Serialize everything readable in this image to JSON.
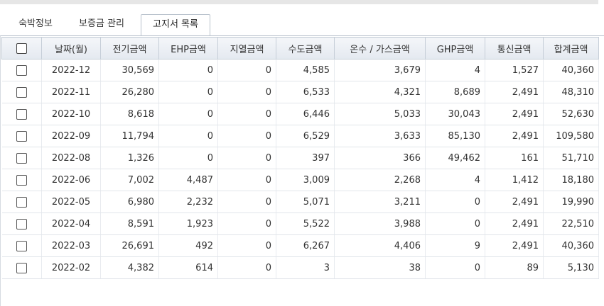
{
  "tabs": [
    "숙박정보",
    "보증금 관리",
    "고지서 목록"
  ],
  "active_tab": 2,
  "columns": [
    "날짜(월)",
    "전기금액",
    "EHP금액",
    "지열금액",
    "수도금액",
    "온수 / 가스금액",
    "GHP금액",
    "통신금액",
    "합계금액"
  ],
  "rows": [
    [
      "2022-12",
      "30,569",
      "0",
      "0",
      "4,585",
      "3,679",
      "4",
      "1,527",
      "40,360"
    ],
    [
      "2022-11",
      "26,280",
      "0",
      "0",
      "6,533",
      "4,321",
      "8,689",
      "2,491",
      "48,310"
    ],
    [
      "2022-10",
      "8,618",
      "0",
      "0",
      "6,446",
      "5,033",
      "30,043",
      "2,491",
      "52,630"
    ],
    [
      "2022-09",
      "11,794",
      "0",
      "0",
      "6,529",
      "3,633",
      "85,130",
      "2,491",
      "109,580"
    ],
    [
      "2022-08",
      "1,326",
      "0",
      "0",
      "397",
      "366",
      "49,462",
      "161",
      "51,710"
    ],
    [
      "2022-06",
      "7,002",
      "4,487",
      "0",
      "3,009",
      "2,268",
      "4",
      "1,412",
      "18,180"
    ],
    [
      "2022-05",
      "6,980",
      "2,232",
      "0",
      "5,071",
      "3,211",
      "0",
      "2,491",
      "19,990"
    ],
    [
      "2022-04",
      "8,591",
      "1,923",
      "0",
      "5,522",
      "3,988",
      "0",
      "2,491",
      "22,510"
    ],
    [
      "2022-03",
      "26,691",
      "492",
      "0",
      "6,267",
      "4,406",
      "9",
      "2,491",
      "40,360"
    ],
    [
      "2022-02",
      "4,382",
      "614",
      "0",
      "3",
      "38",
      "0",
      "89",
      "5,130"
    ]
  ]
}
